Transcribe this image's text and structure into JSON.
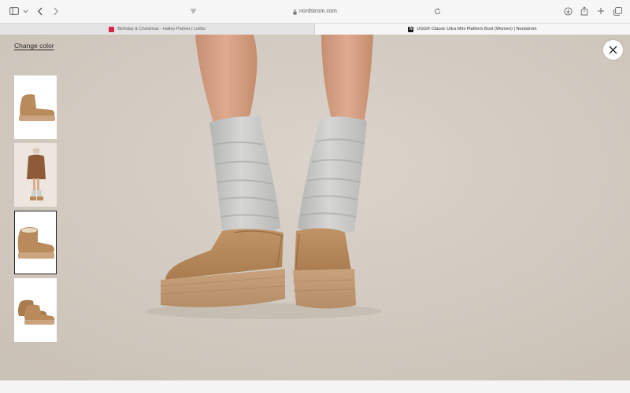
{
  "browser": {
    "url": "nordstrom.com",
    "tabs": [
      {
        "title": "Birthday & Christmas - Hailey Palmer | Listful",
        "active": false
      },
      {
        "title": "UGG® Classic Ultra Mini Platform Boot (Women) | Nordstrom",
        "active": true
      }
    ],
    "favicon_n": "N"
  },
  "viewer": {
    "change_color_label": "Change color",
    "thumbnails": [
      {
        "name": "side-view",
        "selected": false
      },
      {
        "name": "model-full-body",
        "selected": false
      },
      {
        "name": "angled-view",
        "selected": true
      },
      {
        "name": "pair-view",
        "selected": false
      }
    ]
  },
  "colors": {
    "background": "#d3cbc1",
    "boot": "#b98a5b",
    "sock": "#c9c9c7"
  }
}
